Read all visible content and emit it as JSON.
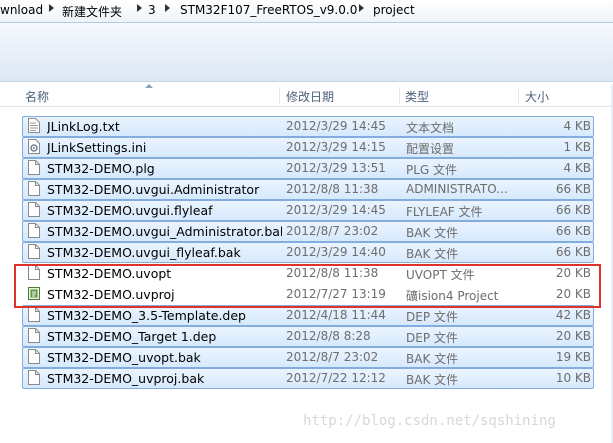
{
  "breadcrumb": {
    "segments": [
      "wnload",
      "新建文件夹",
      "3",
      "STM32F107_FreeRTOS_v9.0.0",
      "project"
    ]
  },
  "columns": {
    "name": "名称",
    "date": "修改日期",
    "type": "类型",
    "size": "大小"
  },
  "files": [
    {
      "name": "JLinkLog.txt",
      "date": "2012/3/29 14:45",
      "type": "文本文档",
      "size": "4 KB",
      "icon": "text-file-icon",
      "selected": true
    },
    {
      "name": "JLinkSettings.ini",
      "date": "2012/3/29 14:15",
      "type": "配置设置",
      "size": "1 KB",
      "icon": "settings-file-icon",
      "selected": true
    },
    {
      "name": "STM32-DEMO.plg",
      "date": "2012/3/29 13:51",
      "type": "PLG 文件",
      "size": "4 KB",
      "icon": "generic-file-icon",
      "selected": true
    },
    {
      "name": "STM32-DEMO.uvgui.Administrator",
      "date": "2012/8/8 11:38",
      "type": "ADMINISTRATO...",
      "size": "66 KB",
      "icon": "generic-file-icon",
      "selected": true
    },
    {
      "name": "STM32-DEMO.uvgui.flyleaf",
      "date": "2012/3/29 14:45",
      "type": "FLYLEAF 文件",
      "size": "66 KB",
      "icon": "generic-file-icon",
      "selected": true
    },
    {
      "name": "STM32-DEMO.uvgui_Administrator.bak",
      "date": "2012/8/7 23:02",
      "type": "BAK 文件",
      "size": "66 KB",
      "icon": "generic-file-icon",
      "selected": true
    },
    {
      "name": "STM32-DEMO.uvgui_flyleaf.bak",
      "date": "2012/3/29 14:40",
      "type": "BAK 文件",
      "size": "66 KB",
      "icon": "generic-file-icon",
      "selected": true
    },
    {
      "name": "STM32-DEMO.uvopt",
      "date": "2012/8/8 11:38",
      "type": "UVOPT 文件",
      "size": "20 KB",
      "icon": "generic-file-icon",
      "selected": false
    },
    {
      "name": "STM32-DEMO.uvproj",
      "date": "2012/7/27 13:19",
      "type": "礦ision4 Project",
      "size": "20 KB",
      "icon": "keil-project-icon",
      "selected": false
    },
    {
      "name": "STM32-DEMO_3.5-Template.dep",
      "date": "2012/4/18 11:44",
      "type": "DEP 文件",
      "size": "42 KB",
      "icon": "generic-file-icon",
      "selected": true
    },
    {
      "name": "STM32-DEMO_Target 1.dep",
      "date": "2012/8/8 8:28",
      "type": "DEP 文件",
      "size": "20 KB",
      "icon": "generic-file-icon",
      "selected": true
    },
    {
      "name": "STM32-DEMO_uvopt.bak",
      "date": "2012/8/7 23:02",
      "type": "BAK 文件",
      "size": "19 KB",
      "icon": "generic-file-icon",
      "selected": true
    },
    {
      "name": "STM32-DEMO_uvproj.bak",
      "date": "2012/7/22 12:12",
      "type": "BAK 文件",
      "size": "10 KB",
      "icon": "generic-file-icon",
      "selected": true
    }
  ],
  "watermark": "http://blog.csdn.net/sqshining",
  "colors": {
    "selection_border": "#84acdd",
    "highlight_box": "#e0322c",
    "header_text": "#4c607a"
  }
}
